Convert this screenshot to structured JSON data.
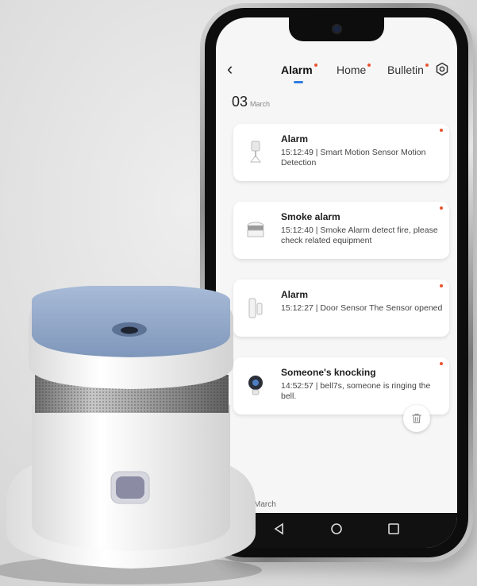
{
  "header": {
    "tabs": [
      {
        "label": "Alarm",
        "active": true
      },
      {
        "label": "Home",
        "active": false
      },
      {
        "label": "Bulletin",
        "active": false
      }
    ]
  },
  "date": {
    "day": "03",
    "month": "March"
  },
  "notifications": [
    {
      "title": "Alarm",
      "text": "15:12:49 | Smart Motion Sensor Motion Detection",
      "icon": "motion-sensor-icon"
    },
    {
      "title": "Smoke alarm",
      "text": "15:12:40 | Smoke Alarm detect fire, please check related equipment",
      "icon": "smoke-detector-icon"
    },
    {
      "title": "Alarm",
      "text": "15:12:27 | Door Sensor The Sensor opened",
      "icon": "door-sensor-icon"
    },
    {
      "title": "Someone's knocking",
      "text": "14:52:57 | bell7s, someone is ringing the bell.",
      "icon": "doorbell-camera-icon"
    }
  ],
  "footer": {
    "date_label": "March"
  },
  "colors": {
    "accent": "#2f7de1",
    "unread_dot": "#e8542e",
    "detector_top": "#8fa6c6"
  }
}
